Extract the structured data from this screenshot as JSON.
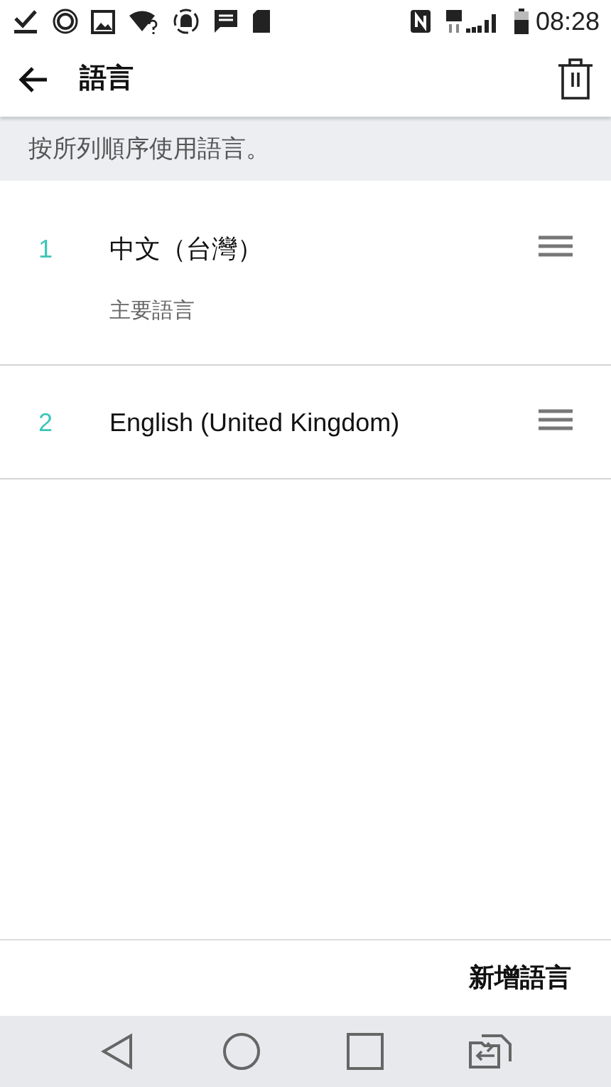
{
  "status_bar": {
    "time": "08:28"
  },
  "app_bar": {
    "title": "語言"
  },
  "hint": "按所列順序使用語言。",
  "languages": [
    {
      "number": "1",
      "name": "中文（台灣）",
      "subtitle": "主要語言"
    },
    {
      "number": "2",
      "name": "English (United Kingdom)"
    }
  ],
  "add_button": "新增語言"
}
